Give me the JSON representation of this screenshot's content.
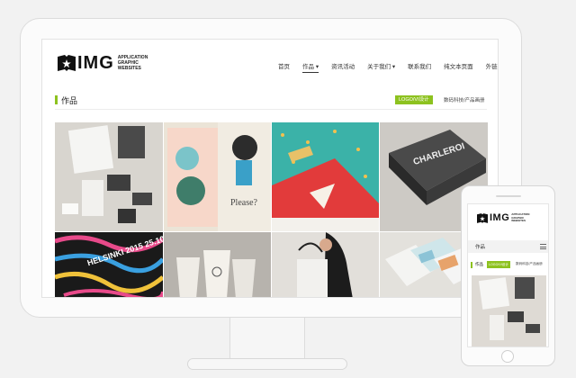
{
  "logo": {
    "word": "IMG",
    "sub1": "APPLICATION",
    "sub2": "GRAPHIC",
    "sub3": "WEBSITES"
  },
  "nav": {
    "items": [
      "首页",
      "作品",
      "资讯活动",
      "关于我们",
      "联系我们",
      "纯文本页面",
      "外链"
    ]
  },
  "section": {
    "title": "作品",
    "tag_active": "LOGO/VI设计",
    "tag_other": "数码科技/产品画册"
  },
  "works": {
    "tiles": [
      {
        "name": "stationery-branding",
        "bg": "#d9d6d0"
      },
      {
        "name": "illustration-book",
        "bg": "#e8e1d4"
      },
      {
        "name": "red-envelope-pattern",
        "bg": "#2fa6a0"
      },
      {
        "name": "charleroi-book",
        "bg": "#3c3c3c",
        "text": "CHARLEROI"
      },
      {
        "name": "helsinki-poster",
        "bg": "#1a1a1a",
        "text": "HELSINKI 2015 25.10."
      },
      {
        "name": "paper-cups",
        "bg": "#bdbab4"
      },
      {
        "name": "tote-bag",
        "bg": "#dcd9d4"
      },
      {
        "name": "brochures",
        "bg": "#e4e2dd"
      }
    ]
  },
  "mobile": {
    "bar_title": "作品",
    "section_title": "作品",
    "tag_active": "LOGO/VI设计",
    "tag_other": "数码科技/产品画册"
  },
  "colors": {
    "accent": "#8dc21f"
  }
}
